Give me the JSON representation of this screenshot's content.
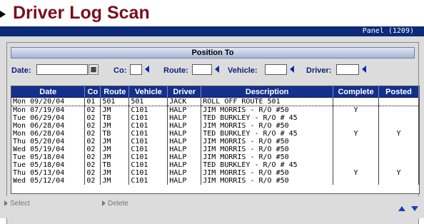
{
  "title": "Driver Log Scan",
  "panel_label": "Panel  (1209)",
  "position_to": "Position To",
  "filters": {
    "date_label": "Date:",
    "co_label": "Co:",
    "route_label": "Route:",
    "vehicle_label": "Vehicle:",
    "driver_label": "Driver:",
    "date_value": "",
    "co_value": "",
    "route_value": "",
    "vehicle_value": "",
    "driver_value": ""
  },
  "columns": [
    "Date",
    "Co",
    "Route",
    "Vehicle",
    "Driver",
    "Description",
    "Complete",
    "Posted"
  ],
  "rows": [
    [
      "Mon 09/20/04",
      "01",
      "501",
      "501",
      "JACK",
      "ROLL OFF ROUTE 501",
      "",
      ""
    ],
    [
      "Mon 07/19/04",
      "02",
      "JM",
      "C101",
      "HALP",
      "JIM MORRIS - R/O #50",
      "Y",
      ""
    ],
    [
      "Tue 06/29/04",
      "02",
      "TB",
      "C101",
      "HALP",
      "TED BURKLEY - R/O # 45",
      "",
      ""
    ],
    [
      "Mon 06/28/04",
      "02",
      "JM",
      "C101",
      "HALP",
      "JIM MORRIS - R/O #50",
      "",
      ""
    ],
    [
      "Mon 06/28/04",
      "02",
      "TB",
      "C101",
      "HALP",
      "TED BURKLEY - R/O # 45",
      "Y",
      "Y"
    ],
    [
      "Thu 05/20/04",
      "02",
      "JM",
      "C101",
      "HALP",
      "JIM MORRIS - R/O #50",
      "",
      ""
    ],
    [
      "Wed 05/19/04",
      "02",
      "JM",
      "C101",
      "HALP",
      "JIM MORRIS - R/O #50",
      "",
      ""
    ],
    [
      "Tue 05/18/04",
      "02",
      "JM",
      "C101",
      "HALP",
      "JIM MORRIS - R/O #50",
      "",
      ""
    ],
    [
      "Tue 05/18/04",
      "02",
      "TB",
      "C101",
      "HALP",
      "TED BURKLEY - R/O # 45",
      "",
      ""
    ],
    [
      "Thu 05/13/04",
      "02",
      "JM",
      "C101",
      "HALP",
      "JIM MORRIS - R/O #50",
      "Y",
      "Y"
    ],
    [
      "Wed 05/12/04",
      "02",
      "JM",
      "C101",
      "HALP",
      "JIM MORRIS - R/O #50",
      "",
      ""
    ]
  ],
  "bottom": {
    "select_label": "Select",
    "delete_label": "Delete"
  },
  "icons": {
    "calendar": "calendar-icon",
    "lookup": "lookup-arrow-icon",
    "scroll_up": "scroll-up-icon",
    "scroll_down": "scroll-down-icon"
  },
  "colors": {
    "title": "#7a0f1c",
    "header_bar": "#0c2a78",
    "grid_header": "#12308c",
    "filter_label": "#0b1f7a"
  }
}
